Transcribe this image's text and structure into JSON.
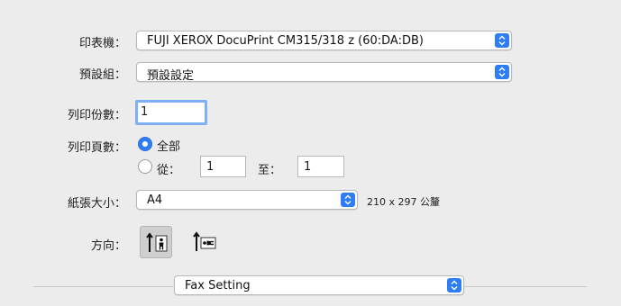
{
  "printer": {
    "label": "印表機：",
    "value": "FUJI XEROX DocuPrint CM315/318 z (60:DA:DB)"
  },
  "presets": {
    "label": "預設組：",
    "value": "預設設定"
  },
  "copies": {
    "label": "列印份數：",
    "value": "1"
  },
  "pages": {
    "label": "列印頁數：",
    "all_label": "全部",
    "from_label": "從：",
    "from_value": "1",
    "to_label": "至：",
    "to_value": "1",
    "selected": "all"
  },
  "paper_size": {
    "label": "紙張大小：",
    "value": "A4",
    "dimensions": "210 x 297 公釐"
  },
  "orientation": {
    "label": "方向：",
    "options": [
      {
        "name": "portrait",
        "selected": true
      },
      {
        "name": "landscape",
        "selected": false
      }
    ]
  },
  "section_popup": {
    "value": "Fax Setting"
  },
  "colors": {
    "accent": "#2f7df6",
    "window_bg": "#ececec"
  },
  "icons": {
    "popup_stepper": "up-down-chevron-icon",
    "portrait": "portrait-orientation-icon",
    "landscape": "landscape-orientation-icon"
  }
}
